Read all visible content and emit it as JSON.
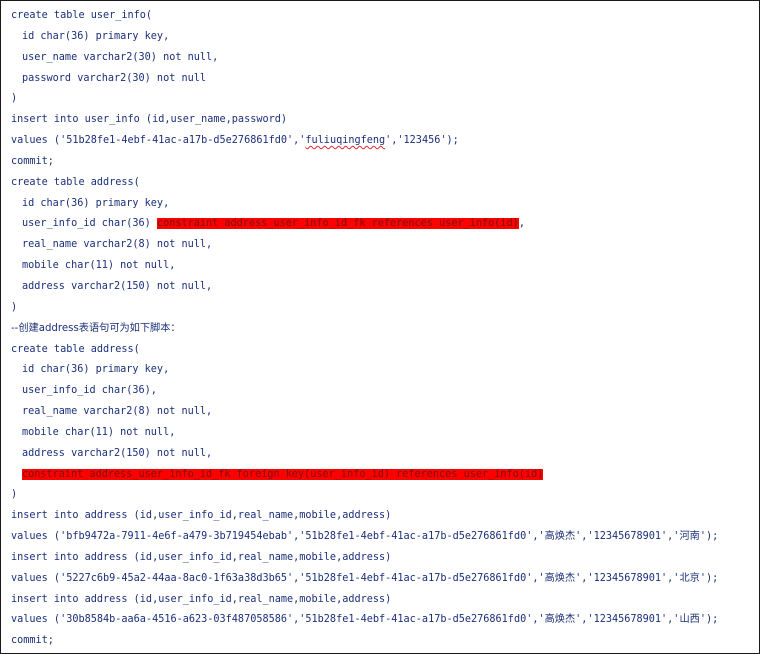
{
  "code": {
    "l01": [
      "create table user_info("
    ],
    "l02": [
      "id char(36) primary key,"
    ],
    "l03": [
      "user_name varchar2(30) not null,"
    ],
    "l04": [
      "password varchar2(30) not null"
    ],
    "l05": [
      ")"
    ],
    "l06": [
      "insert into user_info (id,user_name,password)"
    ],
    "l07": [
      "values ('51b28fe1-4ebf-41ac-a17b-d5e276861fd0','",
      "fuliuqingfeng",
      "','123456');"
    ],
    "l08": [
      "commit;"
    ],
    "l09": [
      "create table address("
    ],
    "l10": [
      "id char(36) primary key,"
    ],
    "l11": [
      "user_info_id char(36) ",
      "constraint address_user_info_id_fk references user_info(id)",
      ","
    ],
    "l12": [
      "real_name varchar2(8) not null,"
    ],
    "l13": [
      "mobile char(11) not null,"
    ],
    "l14": [
      "address varchar2(150) not null,"
    ],
    "l15": [
      ")"
    ],
    "l16": [
      "--创建address表语句可为如下脚本："
    ],
    "l17": [
      "create table address("
    ],
    "l18": [
      "id char(36) primary key,"
    ],
    "l19": [
      "user_info_id char(36),"
    ],
    "l20": [
      "real_name varchar2(8) not null,"
    ],
    "l21": [
      "mobile char(11) not null,"
    ],
    "l22": [
      "address varchar2(150) not null,"
    ],
    "l23": [
      "constraint address_user_info_id_fk foreign key(user_info_id) references user_info(id)"
    ],
    "l24": [
      ")"
    ],
    "l25": [
      "insert into address (id,user_info_id,real_name,mobile,address)"
    ],
    "l26": [
      "values ('bfb9472a-7911-4e6f-a479-3b719454ebab','51b28fe1-4ebf-41ac-a17b-d5e276861fd0','",
      "高焕杰",
      "','12345678901','",
      "河南",
      "');"
    ],
    "l27": [
      "insert into address (id,user_info_id,real_name,mobile,address)"
    ],
    "l28": [
      "values ('5227c6b9-45a2-44aa-8ac0-1f63a38d3b65','51b28fe1-4ebf-41ac-a17b-d5e276861fd0','",
      "高焕杰",
      "','12345678901','",
      "北京",
      "');"
    ],
    "l29": [
      "insert into address (id,user_info_id,real_name,mobile,address)"
    ],
    "l30": [
      "values ('30b8584b-aa6a-4516-a623-03f487058586','51b28fe1-4ebf-41ac-a17b-d5e276861fd0','",
      "高焕杰",
      "','12345678901','",
      "山西",
      "');"
    ],
    "l31": [
      "commit;"
    ]
  }
}
